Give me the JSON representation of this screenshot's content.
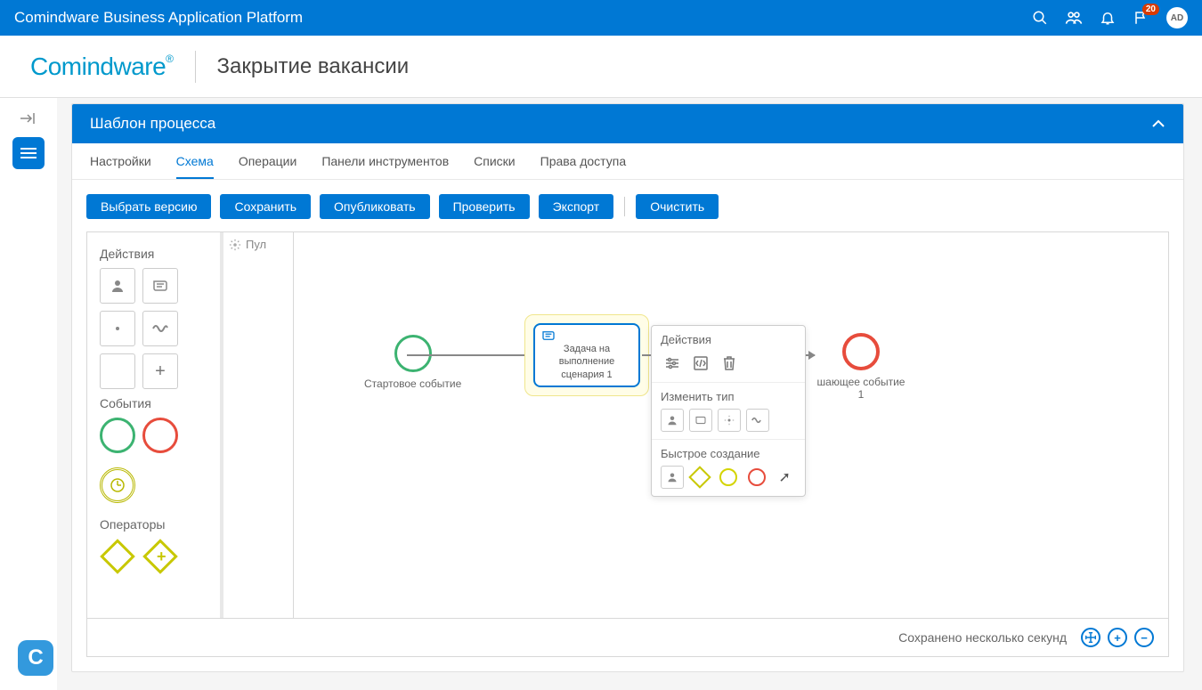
{
  "topbar": {
    "title": "Comindware Business Application Platform",
    "notification_count": "20",
    "user_initials": "AD"
  },
  "header": {
    "logo": "Comindware",
    "page_title": "Закрытие вакансии"
  },
  "panel": {
    "title": "Шаблон процесса"
  },
  "tabs": {
    "settings": "Настройки",
    "scheme": "Схема",
    "operations": "Операции",
    "toolbars": "Панели инструментов",
    "lists": "Списки",
    "permissions": "Права доступа"
  },
  "toolbar": {
    "select_version": "Выбрать версию",
    "save": "Сохранить",
    "publish": "Опубликовать",
    "check": "Проверить",
    "export": "Экспорт",
    "clear": "Очистить"
  },
  "palette": {
    "actions": "Действия",
    "events": "События",
    "operators": "Операторы"
  },
  "canvas": {
    "pool": "Пул",
    "start_event": "Стартовое событие",
    "task_label": "Задача на выполнение сценария 1",
    "end_event": "шающее событие 1"
  },
  "context_menu": {
    "actions": "Действия",
    "change_type": "Изменить тип",
    "quick_create": "Быстрое создание"
  },
  "footer": {
    "saved": "Сохранено несколько секунд"
  }
}
